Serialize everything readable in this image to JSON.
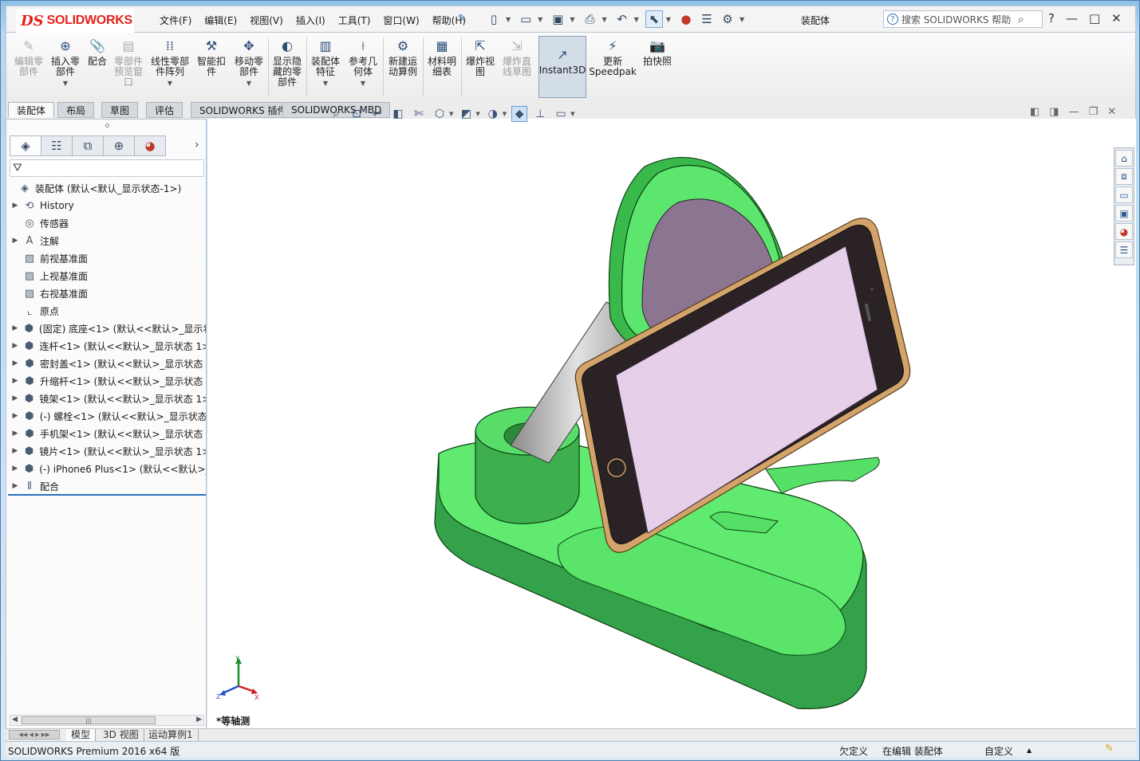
{
  "titlebar": {
    "logo_ds": "DS",
    "logo_text": "SOLIDWORKS",
    "menus": [
      "文件(F)",
      "编辑(E)",
      "视图(V)",
      "插入(I)",
      "工具(T)",
      "窗口(W)",
      "帮助(H)"
    ],
    "document_title": "装配体",
    "help_search_placeholder": "搜索 SOLIDWORKS 帮助",
    "help_q": "?"
  },
  "commands": {
    "edit_component": "编辑零部件",
    "insert_components": "插入零部件",
    "mate": "配合",
    "component_preview": "零部件预览窗口",
    "linear_pattern": "线性零部件阵列",
    "smart_fasteners": "智能扣件",
    "move_component": "移动零部件",
    "show_hidden": "显示隐藏的零部件",
    "assembly_features": "装配体特征",
    "reference_geometry": "参考几何体",
    "new_motion_study": "新建运动算例",
    "bom": "材料明细表",
    "exploded_view": "爆炸视图",
    "explode_line_sketch": "爆炸直线草图",
    "instant3d": "Instant3D",
    "update_speedpak": "更新Speedpak",
    "snapshot": "拍快照"
  },
  "tabs": [
    "装配体",
    "布局",
    "草图",
    "评估",
    "SOLIDWORKS 插件",
    "SOLIDWORKS MBD"
  ],
  "tree": {
    "root": "装配体 (默认<默认_显示状态-1>)",
    "nodes": [
      {
        "label": "History",
        "icon": "history-icon",
        "expandable": true
      },
      {
        "label": "传感器",
        "icon": "sensor-icon",
        "expandable": false
      },
      {
        "label": "注解",
        "icon": "annotation-icon",
        "expandable": true
      },
      {
        "label": "前视基准面",
        "icon": "plane-icon",
        "expandable": false
      },
      {
        "label": "上视基准面",
        "icon": "plane-icon",
        "expandable": false
      },
      {
        "label": "右视基准面",
        "icon": "plane-icon",
        "expandable": false
      },
      {
        "label": "原点",
        "icon": "origin-icon",
        "expandable": false
      },
      {
        "label": "(固定) 底座<1> (默认<<默认>_显示状",
        "icon": "part-icon",
        "expandable": true
      },
      {
        "label": "连杆<1> (默认<<默认>_显示状态 1>",
        "icon": "part-icon",
        "expandable": true
      },
      {
        "label": "密封盖<1> (默认<<默认>_显示状态",
        "icon": "part-icon",
        "expandable": true
      },
      {
        "label": "升缩杆<1> (默认<<默认>_显示状态",
        "icon": "part-icon",
        "expandable": true
      },
      {
        "label": "镜架<1> (默认<<默认>_显示状态 1>",
        "icon": "part-icon",
        "expandable": true
      },
      {
        "label": "(-) 螺栓<1> (默认<<默认>_显示状态",
        "icon": "part-icon",
        "expandable": true
      },
      {
        "label": "手机架<1> (默认<<默认>_显示状态",
        "icon": "part-icon",
        "expandable": true
      },
      {
        "label": "镜片<1> (默认<<默认>_显示状态 1>",
        "icon": "part-icon",
        "expandable": true
      },
      {
        "label": "(-) iPhone6 Plus<1> (默认<<默认>_",
        "icon": "part-icon",
        "expandable": true
      },
      {
        "label": "配合",
        "icon": "mates-icon",
        "expandable": true
      }
    ]
  },
  "viewport": {
    "view_name": "*等轴测",
    "triad": {
      "x": "X",
      "y": "Y",
      "z": "Z"
    }
  },
  "bottom_tabs": [
    "模型",
    "3D 视图",
    "运动算例1"
  ],
  "status": {
    "product": "SOLIDWORKS Premium 2016 x64 版",
    "definition": "欠定义",
    "editing": "在编辑 装配体",
    "units": "自定义",
    "units_arrow": "▲"
  },
  "colors": {
    "model_green": "#5fe86f",
    "model_green_dark": "#3aa64a",
    "phone_screen": "#e6cfe8",
    "phone_gold": "#d4a566",
    "mirror": "#8b7590",
    "rod": "#c4c4c4"
  }
}
